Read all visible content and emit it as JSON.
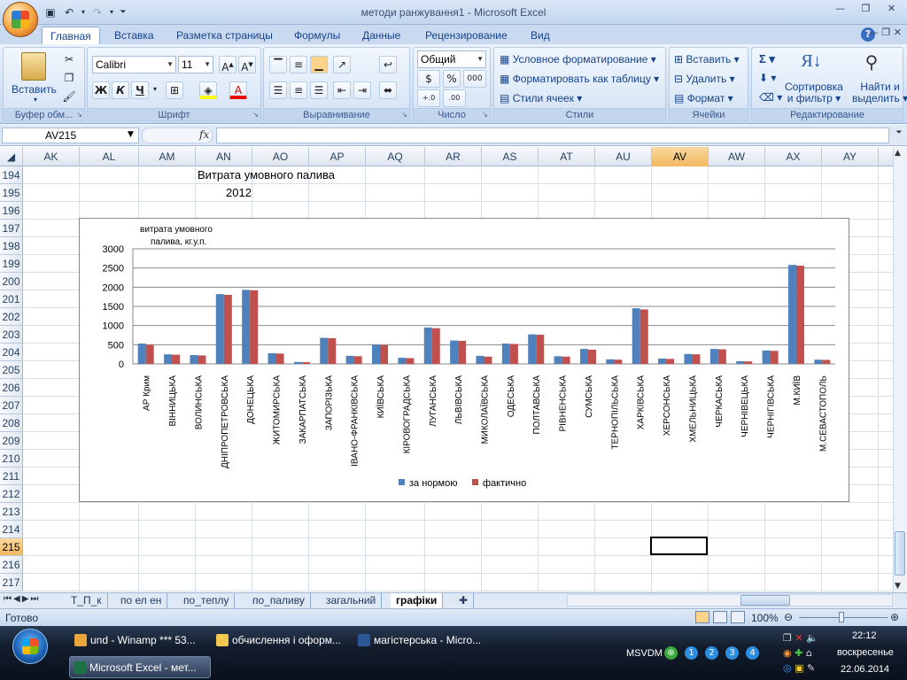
{
  "window": {
    "title": "методи ранжування1 - Microsoft Excel"
  },
  "ribbon_tabs": [
    "Главная",
    "Вставка",
    "Разметка страницы",
    "Формулы",
    "Данные",
    "Рецензирование",
    "Вид"
  ],
  "clipboard": {
    "paste": "Вставить",
    "group": "Буфер обм..."
  },
  "font": {
    "name": "Calibri",
    "size": "11",
    "bold": "Ж",
    "italic": "К",
    "underline": "Ч",
    "group": "Шрифт"
  },
  "alignment": {
    "group": "Выравнивание"
  },
  "number": {
    "format": "Общий",
    "currency": "$",
    "percent": "%",
    "thousands": "000",
    "group": "Число"
  },
  "styles": {
    "conditional": "Условное форматирование",
    "as_table": "Форматировать как таблицу",
    "cell_styles": "Стили ячеек",
    "group": "Стили"
  },
  "cells": {
    "insert": "Вставить",
    "delete": "Удалить",
    "format": "Формат",
    "group": "Ячейки"
  },
  "editing": {
    "sigma": "Σ",
    "sort": "Сортировка\nи фильтр",
    "sort1": "Сортировка",
    "sort2": "и фильтр",
    "find1": "Найти и",
    "find2": "выделить",
    "group": "Редактирование"
  },
  "formula_bar": {
    "name_box": "AV215",
    "fx": "fx",
    "formula": ""
  },
  "columns": [
    "AK",
    "AL",
    "AM",
    "AN",
    "AO",
    "AP",
    "AQ",
    "AR",
    "AS",
    "AT",
    "AU",
    "AV",
    "AW",
    "AX",
    "AY"
  ],
  "selected_column": "AV",
  "rows": [
    "194",
    "195",
    "196",
    "197",
    "198",
    "199",
    "200",
    "201",
    "202",
    "203",
    "204",
    "205",
    "206",
    "207",
    "208",
    "209",
    "210",
    "211",
    "212",
    "213",
    "214",
    "215",
    "216",
    "217"
  ],
  "selected_row": "215",
  "cells_data": {
    "title": "Витрата умовного палива",
    "year": "2012"
  },
  "chart_data": {
    "type": "bar",
    "ylabel_line1": "витрата умовного",
    "ylabel_line2": "палива, кг.у.п.",
    "ylim": [
      0,
      3000
    ],
    "yticks": [
      "3000",
      "2500",
      "2000",
      "1500",
      "1000",
      "500",
      "0"
    ],
    "categories": [
      "АР Крим",
      "ВІННИЦЬКА",
      "ВОЛИНСЬКА",
      "ДНІПРОПЕТРОВСЬКА",
      "ДОНЕЦЬКА",
      "ЖИТОМИРСЬКА",
      "ЗАКАРПАТСЬКА",
      "ЗАПОРІЗЬКА",
      "ІВАНО-ФРАНКІВСЬКА",
      "КИЇВСЬКА",
      "КІРОВОГРАДСЬКА",
      "ЛУГАНСЬКА",
      "ЛЬВІВСЬКА",
      "МИКОЛАЇВСЬКА",
      "ОДЕСЬКА",
      "ПОЛТАВСЬКА",
      "РІВНЕНСЬКА",
      "СУМСЬКА",
      "ТЕРНОПІЛЬСЬКА",
      "ХАРКІВСЬКА",
      "ХЕРСОНСЬКА",
      "ХМЕЛЬНИЦЬКА",
      "ЧЕРКАСЬКА",
      "ЧЕРНІВЕЦЬКА",
      "ЧЕРНІГІВСЬКА",
      "М.КИЇВ",
      "М.СЕВАСТОПОЛЬ"
    ],
    "series": [
      {
        "name": "за нормою",
        "color": "#4f81bd",
        "values": [
          530,
          250,
          230,
          1820,
          1930,
          280,
          50,
          680,
          210,
          500,
          160,
          950,
          610,
          210,
          530,
          770,
          200,
          390,
          120,
          1450,
          140,
          260,
          390,
          70,
          350,
          2580,
          110
        ]
      },
      {
        "name": "фактично",
        "color": "#c0504d",
        "values": [
          500,
          240,
          220,
          1800,
          1920,
          270,
          45,
          670,
          200,
          490,
          150,
          930,
          600,
          190,
          520,
          760,
          190,
          370,
          110,
          1420,
          130,
          250,
          380,
          65,
          340,
          2560,
          105
        ]
      }
    ],
    "legend": "bottom",
    "grid": true
  },
  "sheet_tabs": [
    "Т_П_к",
    "по ел ен",
    "по_теплу",
    "по_паливу",
    "загальний",
    "графіки"
  ],
  "active_sheet": "графіки",
  "status": {
    "ready": "Готово",
    "zoom": "100%"
  },
  "taskbar": {
    "items": [
      "und - Winamp *** 53...",
      "обчислення і оформ...",
      "магістерська - Micro...",
      "Microsoft Excel - мет..."
    ],
    "tray_label": "MSVDM",
    "tray_nums": [
      "1",
      "2",
      "3",
      "4"
    ],
    "time": "22:12",
    "day": "воскресенье",
    "date": "22.06.2014"
  }
}
